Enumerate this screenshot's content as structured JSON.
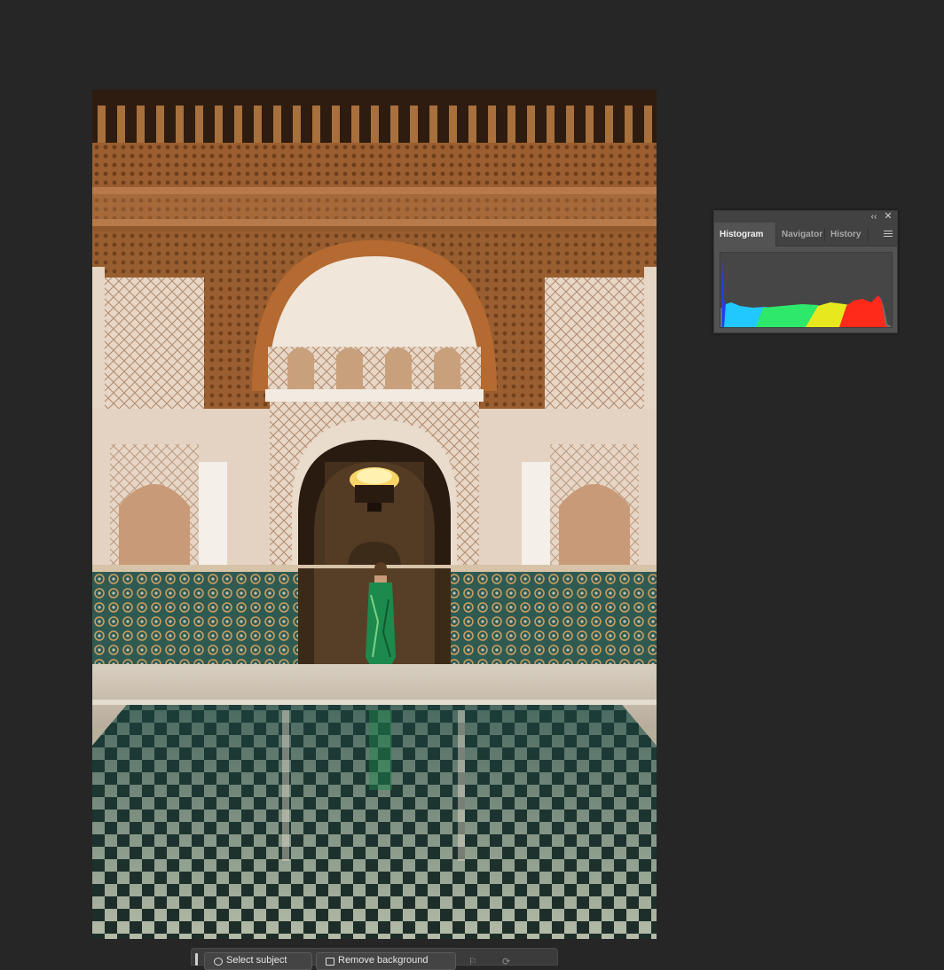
{
  "panel": {
    "collapse_glyph": "‹‹",
    "close_glyph": "✕",
    "tabs": [
      {
        "label": "Histogram",
        "active": true
      },
      {
        "label": "Navigator",
        "active": false
      },
      {
        "label": "History",
        "active": false
      }
    ],
    "menu_icon": "panel-menu-icon",
    "histogram_colors": [
      "#1f3cff",
      "#20c8ff",
      "#2ee86a",
      "#e8e81f",
      "#ff2a1a"
    ]
  },
  "taskbar": {
    "select_subject_label": "Select subject",
    "remove_background_label": "Remove background",
    "icons": [
      "flag-icon",
      "refresh-icon",
      "more-icon"
    ]
  },
  "document": {
    "description_icon": "photo-canvas"
  }
}
